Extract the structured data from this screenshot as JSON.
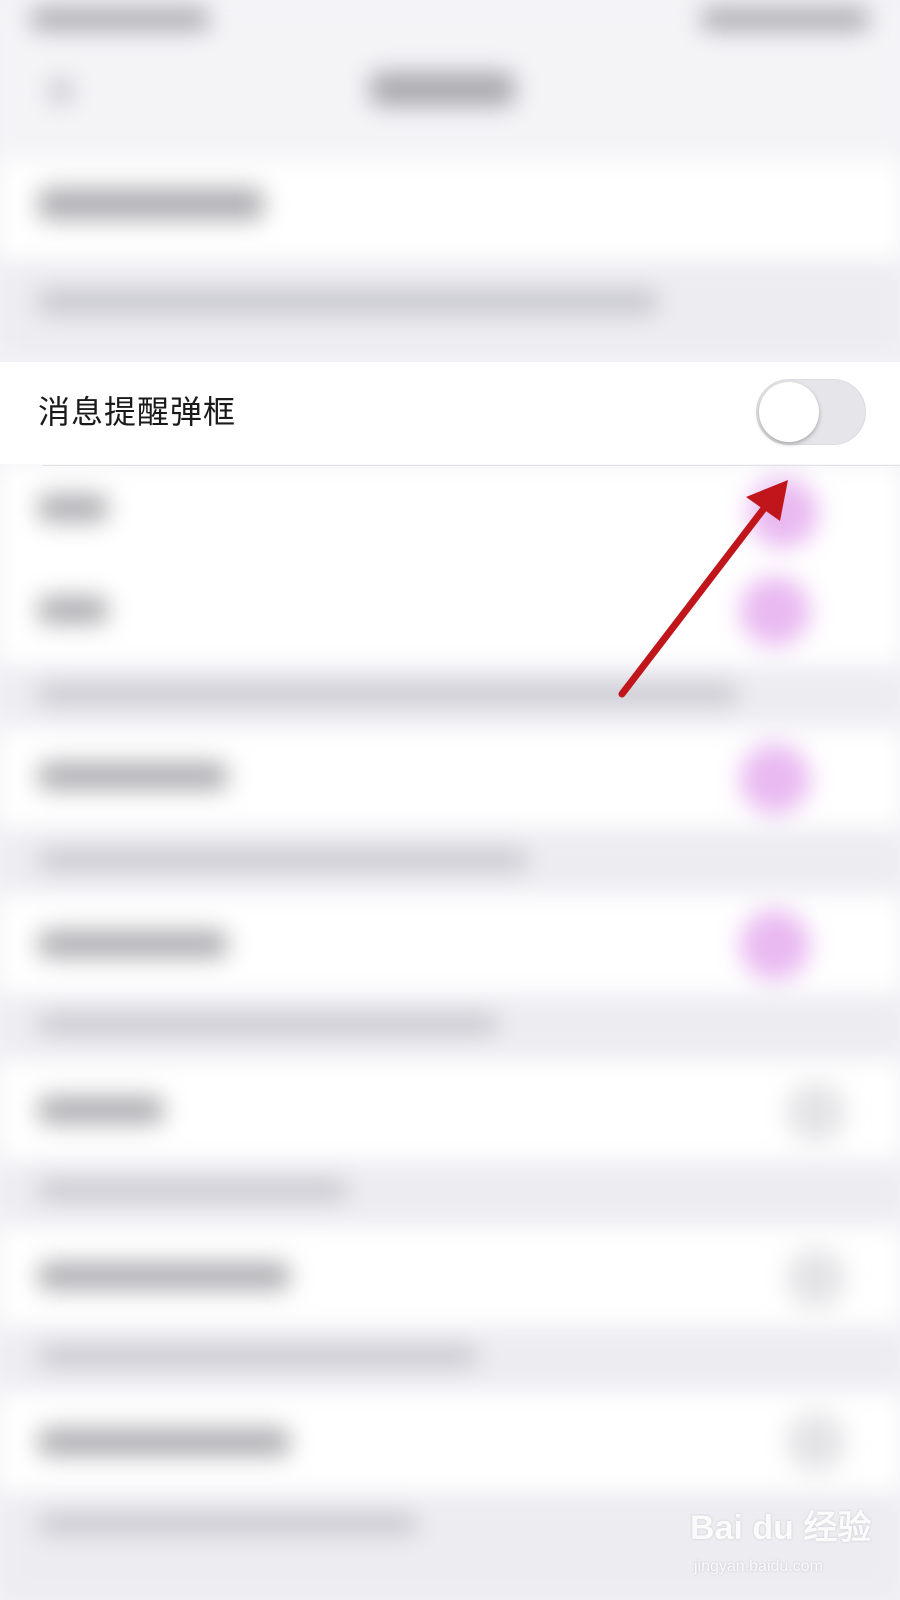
{
  "setting_row": {
    "label": "消息提醒弹框",
    "toggle_on": false
  },
  "annotation": {
    "color": "#c0161b",
    "target": "toggle"
  },
  "watermark": {
    "logo": "Bai du 经验",
    "url": "jingyan.baidu.com"
  },
  "colors": {
    "background": "#f3f3f6",
    "row_background": "#ffffff",
    "toggle_track": "#e6e6ea",
    "accent_pink": "#d77fe6"
  }
}
